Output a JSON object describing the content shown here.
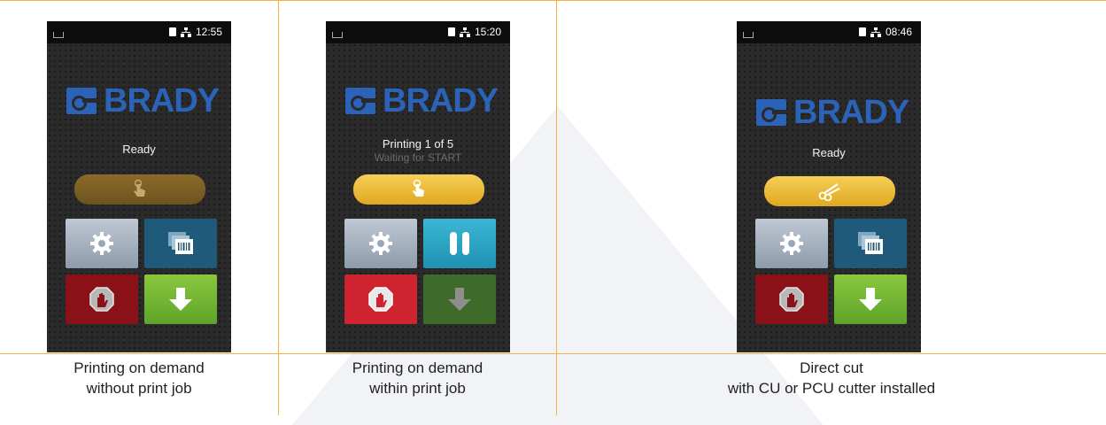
{
  "panels": [
    {
      "time": "12:55",
      "status_title": "Ready",
      "status_sub": "",
      "action_icon": "touch-hand-icon",
      "tiles": [
        "gear-icon",
        "label-stack-icon",
        "stop-hand-icon",
        "arrow-down-icon"
      ],
      "caption_line1": "Printing on demand",
      "caption_line2": "without print job"
    },
    {
      "time": "15:20",
      "status_title": "Printing 1 of 5",
      "status_sub": "Waiting for START",
      "action_icon": "touch-hand-icon",
      "tiles": [
        "gear-icon",
        "pause-icon",
        "stop-hand-icon",
        "arrow-down-icon"
      ],
      "caption_line1": "Printing on demand",
      "caption_line2": "within print job"
    },
    {
      "time": "08:46",
      "status_title": "Ready",
      "status_sub": "",
      "action_icon": "scissors-icon",
      "tiles": [
        "gear-icon",
        "label-stack-icon",
        "stop-hand-icon",
        "arrow-down-icon"
      ],
      "caption_line1": "Direct cut",
      "caption_line2": "with CU or PCU cutter installed"
    }
  ],
  "brand": {
    "name": "BRADY",
    "color": "#2a63b8"
  },
  "colors": {
    "accent": "#f2b441",
    "action": "#e9b533",
    "stop": "#cf2430",
    "feed_ok": "#6cb52e",
    "pause": "#2aa5c8"
  }
}
